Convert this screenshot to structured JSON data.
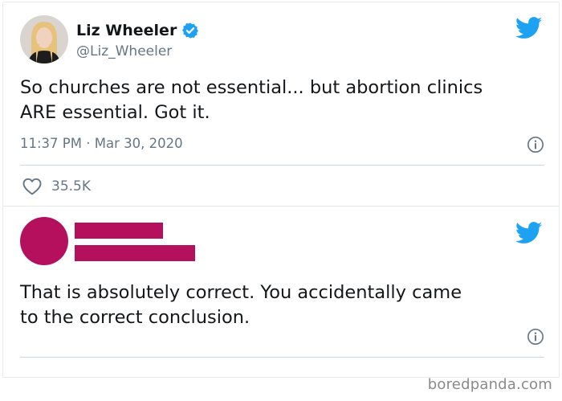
{
  "tweet1": {
    "name": "Liz Wheeler",
    "handle": "@Liz_Wheeler",
    "text": "So churches are not essential... but abortion clinics\nARE essential. Got it.",
    "timestamp": "11:37 PM · Mar 30, 2020",
    "likes": "35.5K",
    "icons": {
      "verified": "verified-badge-icon",
      "bird": "twitter-bird-icon",
      "info": "info-icon",
      "heart": "heart-icon"
    }
  },
  "tweet2": {
    "text": "That is absolutely correct. You accidentally came\nto the correct conclusion.",
    "redaction_color": "#b5105e",
    "icons": {
      "bird": "twitter-bird-icon",
      "info": "info-icon"
    }
  },
  "watermark": "boredpanda.com",
  "colors": {
    "twitter_blue": "#1da1f2",
    "text": "#14171a",
    "secondary_text": "#657786",
    "redaction": "#b5105e"
  }
}
